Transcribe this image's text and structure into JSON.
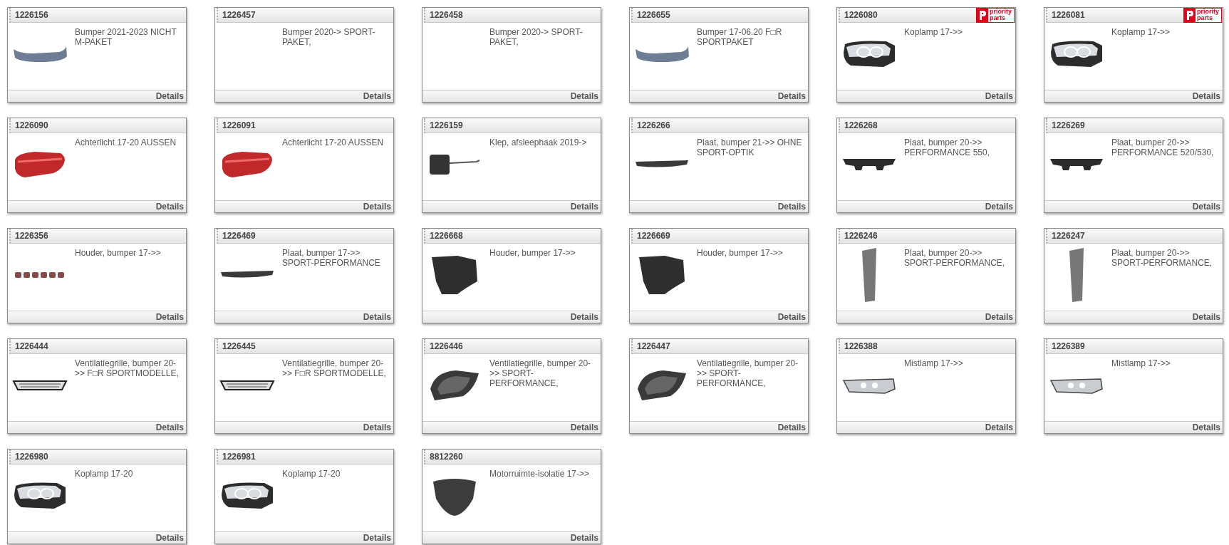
{
  "products": [
    {
      "number": "1226156",
      "description": "Bumper 2021-2023 NICHT M-PAKET",
      "kind": "bumper",
      "link": "Details"
    },
    {
      "number": "1226457",
      "description": "Bumper 2020-> SPORT-PAKET,",
      "link": "Details"
    },
    {
      "number": "1226458",
      "description": "Bumper 2020-> SPORT-PAKET,",
      "link": "Details"
    },
    {
      "number": "1226655",
      "description": "Bumper 17-06.20 F□R SPORTPAKET",
      "kind": "bumper",
      "link": "Details"
    },
    {
      "number": "1226080",
      "description": "Koplamp 17->>",
      "kind": "headlamp",
      "badge": [
        "priority",
        "parts"
      ],
      "link": "Details"
    },
    {
      "number": "1226081",
      "description": "Koplamp 17->>",
      "kind": "headlamp",
      "badge": [
        "priority",
        "parts"
      ],
      "link": "Details"
    },
    {
      "number": "1226090",
      "description": "Achterlicht 17-20 AUSSEN",
      "kind": "taillight",
      "link": "Details"
    },
    {
      "number": "1226091",
      "description": "Achterlicht 17-20 AUSSEN",
      "kind": "taillight",
      "link": "Details"
    },
    {
      "number": "1226159",
      "description": "Klep, afsleephaak 2019->",
      "kind": "cover",
      "link": "Details"
    },
    {
      "number": "1226266",
      "description": "Plaat, bumper 21->> OHNE SPORT-OPTIK",
      "kind": "strip",
      "link": "Details"
    },
    {
      "number": "1226268",
      "description": "Plaat, bumper 20->> PERFORMANCE 550,",
      "kind": "diffuser",
      "link": "Details"
    },
    {
      "number": "1226269",
      "description": "Plaat, bumper 20->> PERFORMANCE 520/530,",
      "kind": "diffuser",
      "link": "Details"
    },
    {
      "number": "1226356",
      "description": "Houder, bumper 17->>",
      "kind": "clips",
      "link": "Details"
    },
    {
      "number": "1226469",
      "description": "Plaat, bumper 17->> SPORT-PERFORMANCE",
      "kind": "strip",
      "link": "Details"
    },
    {
      "number": "1226668",
      "description": "Houder, bumper 17->>",
      "kind": "holder",
      "link": "Details"
    },
    {
      "number": "1226669",
      "description": "Houder, bumper 17->>",
      "kind": "holder",
      "link": "Details"
    },
    {
      "number": "1226246",
      "description": "Plaat, bumper 20->> SPORT-PERFORMANCE,",
      "kind": "panel",
      "link": "Details"
    },
    {
      "number": "1226247",
      "description": "Plaat, bumper 20->> SPORT-PERFORMANCE,",
      "kind": "panel",
      "link": "Details"
    },
    {
      "number": "1226444",
      "description": "Ventilatiegrille, bumper 20->> F□R SPORTMODELLE,",
      "kind": "grille",
      "link": "Details"
    },
    {
      "number": "1226445",
      "description": "Ventilatiegrille, bumper 20->> F□R SPORTMODELLE,",
      "kind": "grille",
      "link": "Details"
    },
    {
      "number": "1226446",
      "description": "Ventilatiegrille, bumper 20->> SPORT-PERFORMANCE,",
      "kind": "mesh",
      "link": "Details"
    },
    {
      "number": "1226447",
      "description": "Ventilatiegrille, bumper 20->> SPORT-PERFORMANCE,",
      "kind": "mesh",
      "link": "Details"
    },
    {
      "number": "1226388",
      "description": "Mistlamp 17->>",
      "kind": "foglamp",
      "link": "Details"
    },
    {
      "number": "1226389",
      "description": "Mistlamp 17->>",
      "kind": "foglamp",
      "link": "Details"
    },
    {
      "number": "1226980",
      "description": "Koplamp 17-20",
      "kind": "headlamp",
      "link": "Details"
    },
    {
      "number": "1226981",
      "description": "Koplamp 17-20",
      "kind": "headlamp",
      "link": "Details"
    },
    {
      "number": "8812260",
      "description": "Motorruimte-isolatie 17->>",
      "kind": "insulation",
      "link": "Details"
    }
  ]
}
